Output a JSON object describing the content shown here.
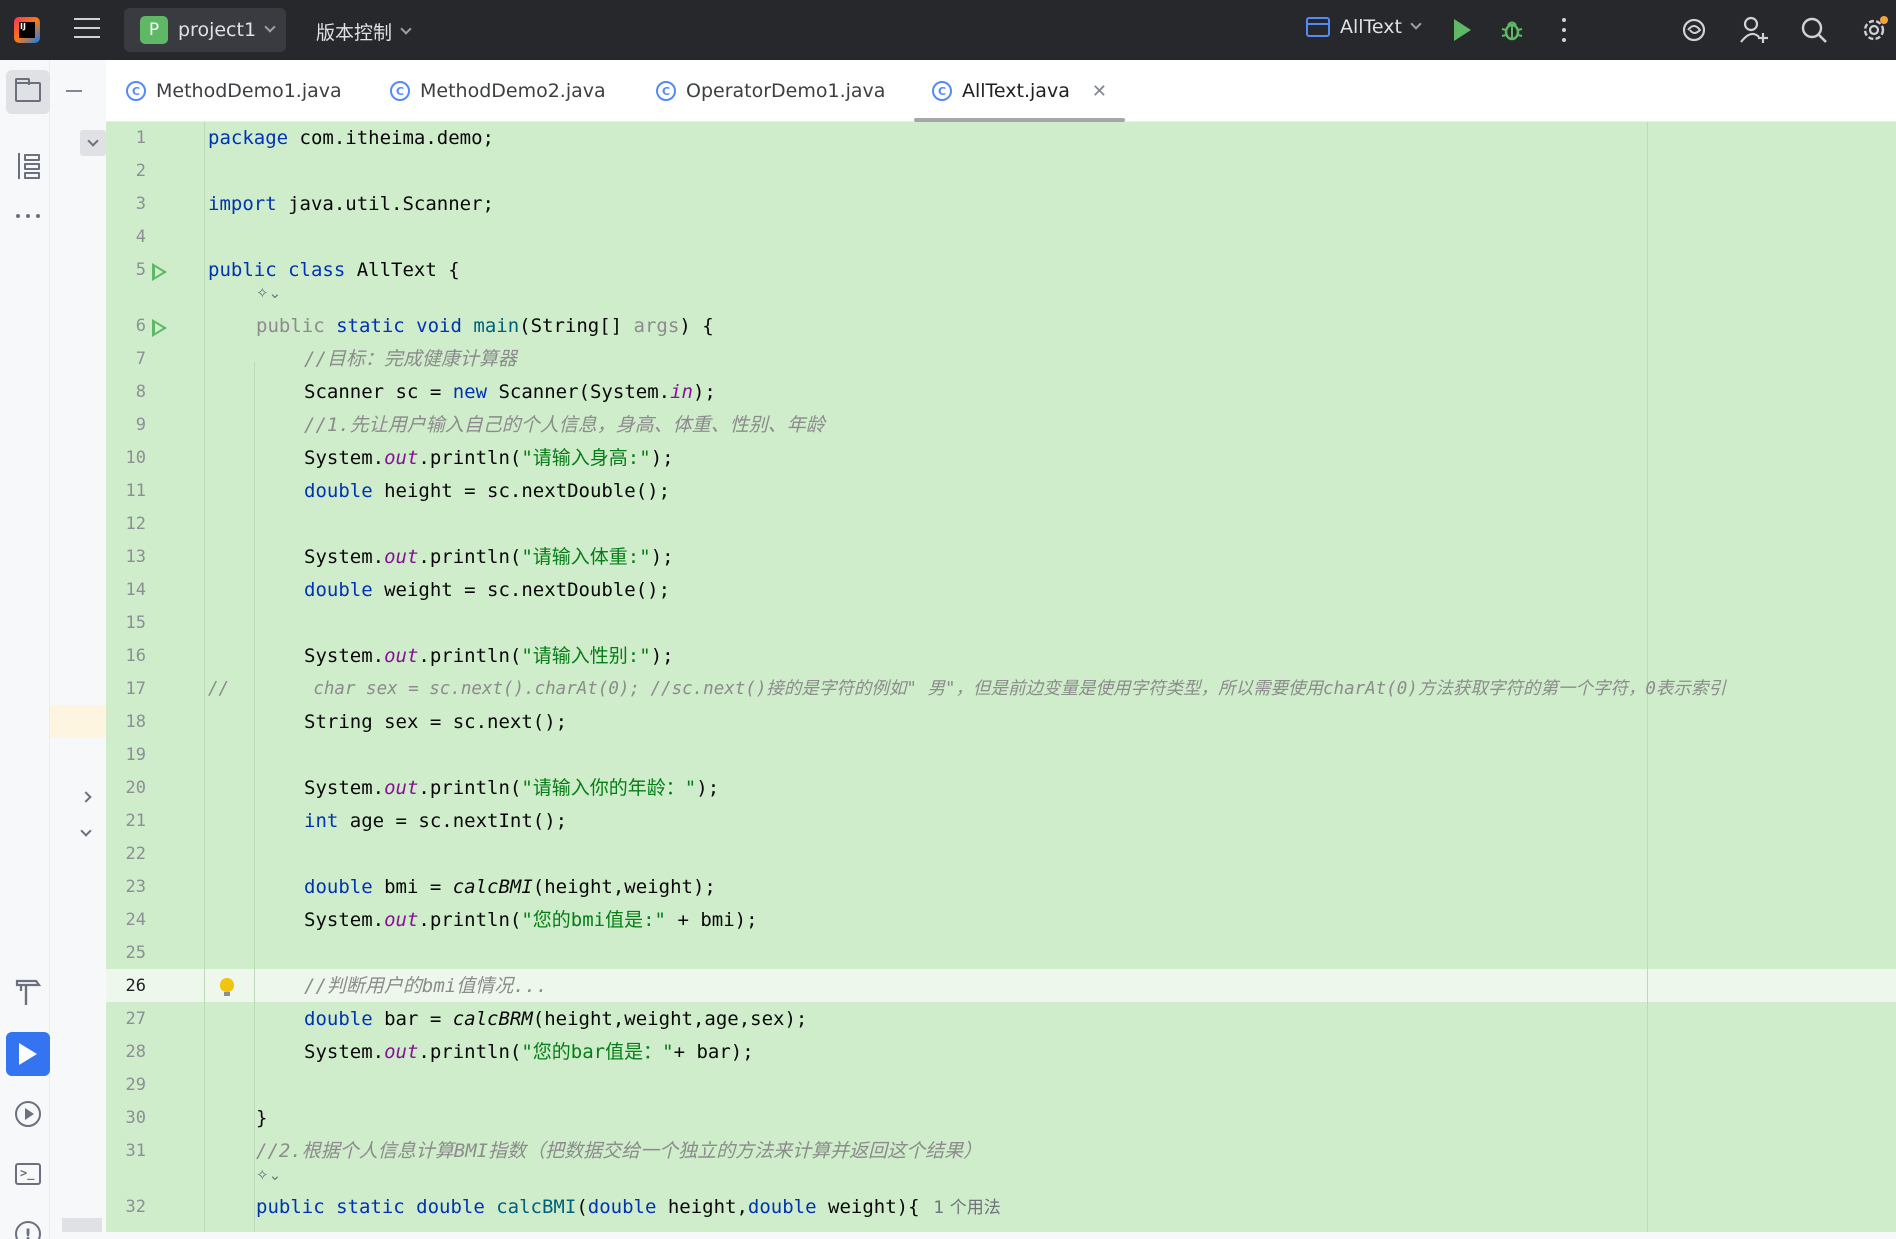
{
  "topbar": {
    "logo_text": "IJ",
    "project_badge": "P",
    "project_name": "project1",
    "vcs_label": "版本控制",
    "run_config": "AllText"
  },
  "tabs": [
    {
      "label": "MethodDemo1.java",
      "active": false
    },
    {
      "label": "MethodDemo2.java",
      "active": false
    },
    {
      "label": "OperatorDemo1.java",
      "active": false
    },
    {
      "label": "AllText.java",
      "active": true
    }
  ],
  "editor": {
    "current_line": "26",
    "line_numbers": [
      "1",
      "2",
      "3",
      "4",
      "5",
      "6",
      "7",
      "8",
      "9",
      "10",
      "11",
      "12",
      "13",
      "14",
      "15",
      "16",
      "17",
      "18",
      "19",
      "20",
      "21",
      "22",
      "23",
      "24",
      "25",
      "26",
      "27",
      "28",
      "29",
      "30",
      "31",
      "32"
    ],
    "code": {
      "l1_a": "package",
      "l1_b": " com.itheima.demo;",
      "l3_a": "import",
      "l3_b": " java.util.Scanner;",
      "l5_a": "public class",
      "l5_b": " AllText {",
      "l6_a": "public",
      "l6_b": "static void",
      "l6_c": "main",
      "l6_d": "(String[] ",
      "l6_e": "args",
      "l6_f": ") {",
      "l7": "//目标：完成健康计算器",
      "l8_a": "Scanner sc = ",
      "l8_b": "new",
      "l8_c": " Scanner(System.",
      "l8_d": "in",
      "l8_e": ");",
      "l9": "//1.先让用户输入自己的个人信息，身高、体重、性别、年龄",
      "l10_a": "System.",
      "l10_b": "out",
      "l10_c": ".println(",
      "l10_d": "\"请输入身高:\"",
      "l10_e": ");",
      "l11_a": "double",
      "l11_b": " height = sc.nextDouble();",
      "l13_a": "System.",
      "l13_b": "out",
      "l13_c": ".println(",
      "l13_d": "\"请输入体重:\"",
      "l13_e": ");",
      "l14_a": "double",
      "l14_b": " weight = sc.nextDouble();",
      "l16_a": "System.",
      "l16_b": "out",
      "l16_c": ".println(",
      "l16_d": "\"请输入性别:\"",
      "l16_e": ");",
      "l17": "//        char sex = sc.next().charAt(0); //sc.next()接的是字符的例如\" 男\"，但是前边变量是使用字符类型，所以需要使用charAt(0)方法获取字符的第一个字符，0表示索引",
      "l18": "String sex = sc.next();",
      "l20_a": "System.",
      "l20_b": "out",
      "l20_c": ".println(",
      "l20_d": "\"请输入你的年龄：\"",
      "l20_e": ");",
      "l21_a": "int",
      "l21_b": " age = sc.nextInt();",
      "l23_a": "double",
      "l23_b": " bmi = ",
      "l23_c": "calcBMI",
      "l23_d": "(height,weight);",
      "l24_a": "System.",
      "l24_b": "out",
      "l24_c": ".println(",
      "l24_d": "\"您的bmi值是:\"",
      "l24_e": " + bmi);",
      "l26": "//判断用户的bmi值情况...",
      "l27_a": "double",
      "l27_b": " bar = ",
      "l27_c": "calcBRM",
      "l27_d": "(height,weight,age,sex);",
      "l28_a": "System.",
      "l28_b": "out",
      "l28_c": ".println(",
      "l28_d": "\"您的bar值是：\"",
      "l28_e": "+ bar);",
      "l30": "}",
      "l31": "//2.根据个人信息计算BMI指数（把数据交给一个独立的方法来计算并返回这个结果）",
      "l32_a": "public static double",
      "l32_b": "calcBMI",
      "l32_c": "(",
      "l32_d": "double",
      "l32_e": " height,",
      "l32_f": "double",
      "l32_g": " weight){",
      "l32_hint": "1 个用法"
    }
  },
  "colors": {
    "editor_bg": "#cfeccb",
    "keyword": "#0033b3",
    "string": "#067d17",
    "comment": "#8c8c8c",
    "static_field": "#871094",
    "accent": "#3574f0"
  },
  "icons": [
    "hamburger-icon",
    "folder-icon",
    "structure-icon",
    "more-icon",
    "build-icon",
    "run-icon",
    "services-icon",
    "terminal-icon",
    "problems-icon",
    "run-green-icon",
    "debug-icon",
    "ai-assistant-icon",
    "add-user-icon",
    "search-icon",
    "settings-icon",
    "class-icon",
    "close-icon",
    "bulb-icon"
  ]
}
